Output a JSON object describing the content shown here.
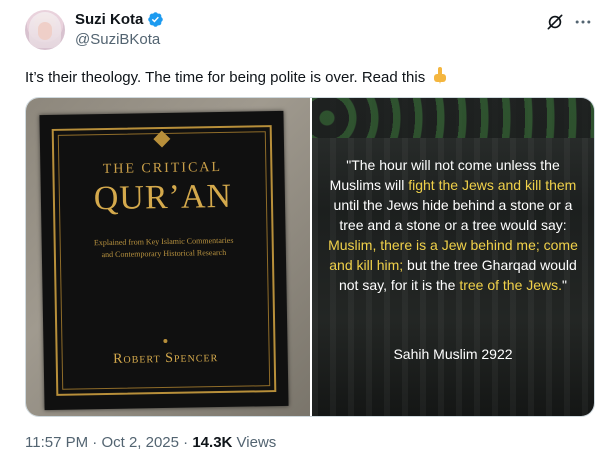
{
  "author": {
    "display_name": "Suzi Kota",
    "handle": "@SuziBKota"
  },
  "tweet": {
    "text": "It’s their theology. The time for being polite is over. Read this"
  },
  "media": {
    "book_cover": {
      "title_line1": "THE CRITICAL",
      "title_line2": "QUR’AN",
      "subtitle_line1": "Explained from Key Islamic Commentaries",
      "subtitle_line2": "and Contemporary Historical Research",
      "author": "Robert Spencer"
    },
    "quote_image": {
      "parts": [
        {
          "text": "\"The hour will not come unless the Muslims will ",
          "highlight": false
        },
        {
          "text": "fight the Jews and kill them",
          "highlight": true
        },
        {
          "text": " until the Jews hide behind a stone or a tree and a stone or a tree would say: ",
          "highlight": false
        },
        {
          "text": "Muslim, there is a Jew behind me; come and kill him;",
          "highlight": true
        },
        {
          "text": " but the tree Gharqad would not say, for it is the ",
          "highlight": false
        },
        {
          "text": "tree of the Jews.",
          "highlight": true
        },
        {
          "text": "\"",
          "highlight": false
        }
      ],
      "source": "Sahih Muslim 2922",
      "highlight_color": "#f0d14a"
    }
  },
  "meta": {
    "time": "11:57 PM",
    "separator": " · ",
    "date": "Oct 2, 2025",
    "views_count": "14.3K",
    "views_label": "Views"
  },
  "icons": {
    "verified": "verified-badge-icon",
    "grok": "grok-icon",
    "more": "more-options-icon",
    "emoji": "pointing-down-emoji"
  },
  "colors": {
    "verified": "#1d9bf0",
    "secondary_text": "#536471",
    "primary_text": "#0f1419"
  }
}
